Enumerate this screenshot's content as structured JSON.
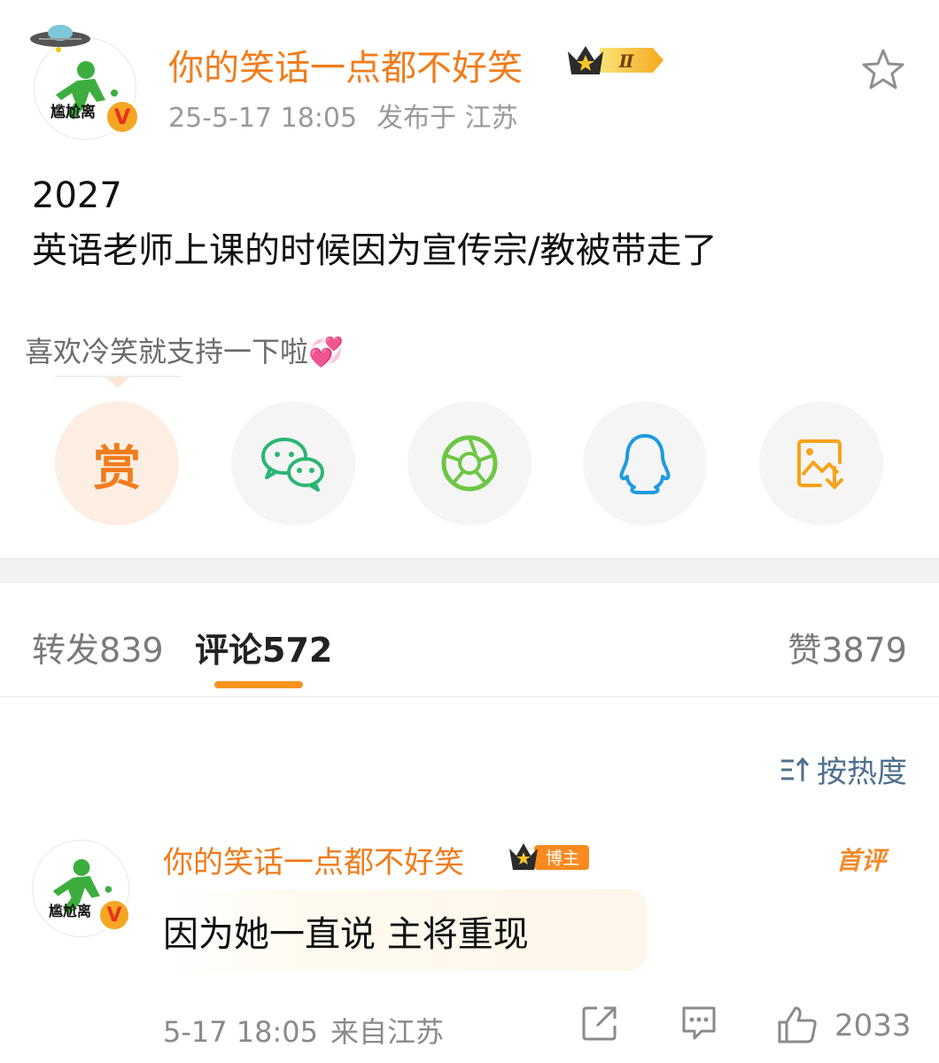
{
  "post": {
    "username": "你的笑话一点都不好笑",
    "avatar_label": "尴尬离",
    "verified_mark": "V",
    "crown_level": "Ⅱ",
    "time": "25-5-17 18:05",
    "location": "发布于 江苏",
    "body": "2027\n英语老师上课的时候因为宣传宗/教被带走了",
    "support_text": "喜欢冷笑就支持一下啦💞"
  },
  "share": [
    {
      "name": "reward",
      "label": "赏",
      "icon": "reward-icon",
      "color": "#f07c1c"
    },
    {
      "name": "wechat",
      "icon": "wechat-icon",
      "color": "#2bb673"
    },
    {
      "name": "moments",
      "icon": "wechat-moments-icon",
      "color": "#6cc644"
    },
    {
      "name": "qq",
      "icon": "qq-icon",
      "color": "#1e9be0"
    },
    {
      "name": "save-image",
      "icon": "save-image-icon",
      "color": "#f7a21b"
    }
  ],
  "tabs": {
    "repost_label": "转发",
    "repost_count": "839",
    "comment_label": "评论",
    "comment_count": "572",
    "like_label": "赞",
    "like_count": "3879",
    "active": "comment"
  },
  "sort": {
    "label": "按热度"
  },
  "comment": {
    "username": "你的笑话一点都不好笑",
    "avatar_label": "尴尬离",
    "verified_mark": "V",
    "author_badge": "博主",
    "first_tag": "首评",
    "text": "因为她一直说 主将重现",
    "time": "5-17 18:05",
    "source": "来自江苏",
    "likes": "2033"
  },
  "colors": {
    "accent": "#f07c1c",
    "tab_indicator": "#f7931e",
    "sort_blue": "#4f6f90"
  }
}
